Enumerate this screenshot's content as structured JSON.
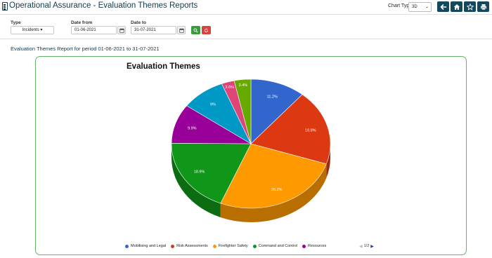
{
  "header": {
    "title": "Operational Assurance - Evaluation Themes Reports",
    "chart_type_label": "Chart Type",
    "chart_type_value": "3D",
    "buttons": [
      {
        "name": "back-button",
        "icon": "arrow-left-icon"
      },
      {
        "name": "home-button",
        "icon": "home-icon"
      },
      {
        "name": "favourite-button",
        "icon": "star-icon"
      },
      {
        "name": "print-button",
        "icon": "printer-icon"
      }
    ]
  },
  "filters": {
    "type_label": "Type",
    "type_value": "Incidents",
    "date_from_label": "Date from",
    "date_from_value": "01-06-2021",
    "date_to_label": "Date to",
    "date_to_value": "31-07-2021"
  },
  "report": {
    "heading": "Evaluation Themes Report for period 01-06-2021 to 31-07-2021"
  },
  "chart_data": {
    "type": "pie",
    "style": "3d",
    "title": "Evaluation Themes",
    "categories": [
      "Mobilising and Legal",
      "Risk Assessments",
      "Firefighter Safety",
      "Command and Control",
      "Resources",
      "",
      "",
      ""
    ],
    "values": [
      11.2,
      18.9,
      26.2,
      18.9,
      9.9,
      9,
      2.6,
      3.4
    ],
    "value_labels": [
      "11.2%",
      "18.9%",
      "26.2%",
      "18.9%",
      "9.9%",
      "9%",
      "2.6%",
      "3.4%"
    ],
    "colors": [
      "#3366cc",
      "#dc3912",
      "#ff9900",
      "#109618",
      "#990099",
      "#0099c6",
      "#dd4477",
      "#66aa00"
    ],
    "legend_position": "bottom",
    "legend_visible": [
      "Mobilising and Legal",
      "Risk Assessments",
      "Firefighter Safety",
      "Command and Control",
      "Resources"
    ],
    "legend_page": "1/2"
  },
  "colors": {
    "header_text": "#123a4f",
    "nav_button": "#14485f",
    "panel_border": "#62b562",
    "search_button": "#3a9a3e",
    "reset_button": "#d9423e"
  }
}
